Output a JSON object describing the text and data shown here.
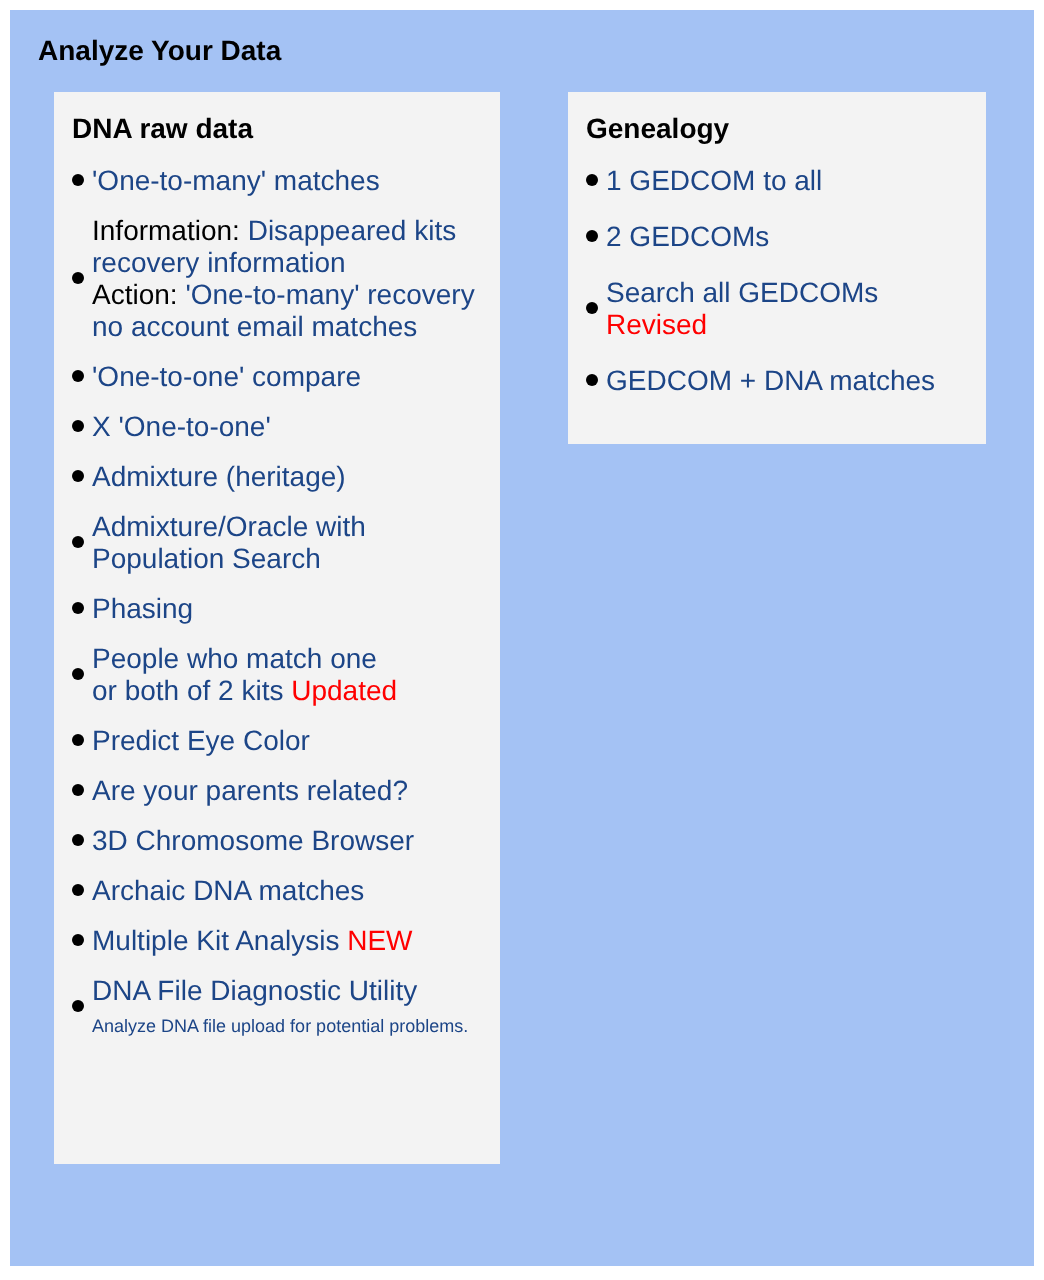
{
  "title": "Analyze Your Data",
  "panels": [
    {
      "heading": "DNA raw data",
      "items": [
        {
          "lines": [
            [
              {
                "kind": "link",
                "text": "'One-to-many' matches"
              }
            ]
          ]
        },
        {
          "lines": [
            [
              {
                "kind": "text",
                "text": "Information:"
              },
              {
                "kind": "link",
                "text": "Disappeared kits"
              }
            ],
            [
              {
                "kind": "link",
                "text": "recovery information"
              }
            ],
            [
              {
                "kind": "text",
                "text": "Action:"
              },
              {
                "kind": "link",
                "text": "'One-to-many' recovery"
              }
            ],
            [
              {
                "kind": "link",
                "text": "no account email matches"
              }
            ]
          ]
        },
        {
          "lines": [
            [
              {
                "kind": "link",
                "text": "'One-to-one' compare"
              }
            ]
          ]
        },
        {
          "lines": [
            [
              {
                "kind": "link",
                "text": "X 'One-to-one'"
              }
            ]
          ]
        },
        {
          "lines": [
            [
              {
                "kind": "link",
                "text": "Admixture (heritage)"
              }
            ]
          ]
        },
        {
          "lines": [
            [
              {
                "kind": "link",
                "text": "Admixture/Oracle with"
              }
            ],
            [
              {
                "kind": "link",
                "text": "Population Search"
              }
            ]
          ]
        },
        {
          "lines": [
            [
              {
                "kind": "link",
                "text": "Phasing"
              }
            ]
          ]
        },
        {
          "lines": [
            [
              {
                "kind": "link",
                "text": "People who match one"
              }
            ],
            [
              {
                "kind": "link",
                "text": "or both of 2 kits"
              },
              {
                "kind": "tag",
                "text": "Updated"
              }
            ]
          ]
        },
        {
          "lines": [
            [
              {
                "kind": "link",
                "text": "Predict Eye Color"
              }
            ]
          ]
        },
        {
          "lines": [
            [
              {
                "kind": "link",
                "text": "Are your parents related?"
              }
            ]
          ]
        },
        {
          "lines": [
            [
              {
                "kind": "link",
                "text": "3D Chromosome Browser"
              }
            ]
          ]
        },
        {
          "lines": [
            [
              {
                "kind": "link",
                "text": "Archaic DNA matches"
              }
            ]
          ]
        },
        {
          "lines": [
            [
              {
                "kind": "link",
                "text": "Multiple Kit Analysis"
              },
              {
                "kind": "tag",
                "text": "NEW"
              }
            ]
          ]
        },
        {
          "lines": [
            [
              {
                "kind": "link",
                "text": "DNA File Diagnostic Utility"
              }
            ],
            [
              {
                "kind": "note",
                "text": "Analyze DNA file upload for potential problems."
              }
            ]
          ]
        }
      ]
    },
    {
      "heading": "Genealogy",
      "items": [
        {
          "lines": [
            [
              {
                "kind": "link",
                "text": "1 GEDCOM to all"
              }
            ]
          ]
        },
        {
          "lines": [
            [
              {
                "kind": "link",
                "text": "2 GEDCOMs"
              }
            ]
          ]
        },
        {
          "lines": [
            [
              {
                "kind": "link",
                "text": "Search all GEDCOMs"
              }
            ],
            [
              {
                "kind": "tag",
                "text": "Revised"
              }
            ]
          ]
        },
        {
          "lines": [
            [
              {
                "kind": "link",
                "text": "GEDCOM + DNA matches"
              }
            ]
          ]
        }
      ]
    }
  ]
}
